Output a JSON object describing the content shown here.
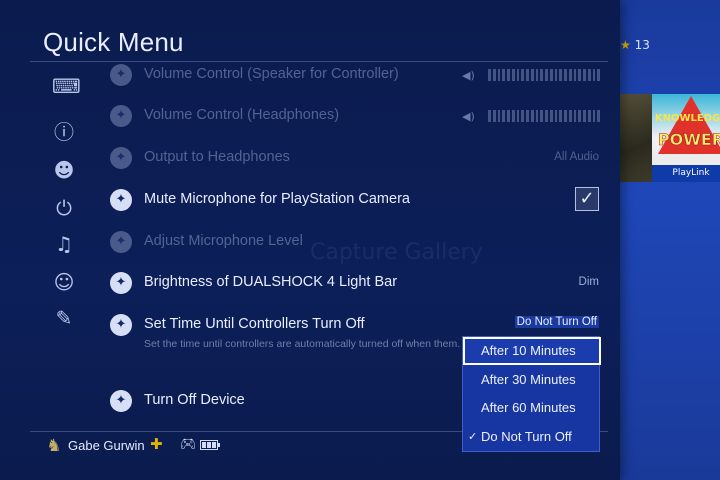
{
  "header": {
    "title": "Quick Menu",
    "trophy_count": "13"
  },
  "background": {
    "ghost_text": "Capture Gallery",
    "game_title_top": "KNOWLEDGE",
    "game_title": "POWER",
    "playlink": "PlayLink"
  },
  "sidebar": {
    "icons": [
      "controller-settings-icon",
      "info-icon",
      "party-icon",
      "power-icon",
      "music-icon",
      "dualshock-icon",
      "customize-icon"
    ]
  },
  "settings": [
    {
      "label": "Volume Control (Speaker for Controller)",
      "type": "slider",
      "enabled": false
    },
    {
      "label": "Volume Control (Headphones)",
      "type": "slider",
      "enabled": false
    },
    {
      "label": "Output to Headphones",
      "value": "All Audio",
      "enabled": false
    },
    {
      "label": "Mute Microphone for PlayStation Camera",
      "type": "checkbox",
      "checked": true,
      "enabled": true
    },
    {
      "label": "Adjust Microphone Level",
      "enabled": false
    },
    {
      "label": "Brightness of DUALSHOCK 4 Light Bar",
      "value": "Dim",
      "enabled": true
    },
    {
      "label": "Set Time Until Controllers Turn Off",
      "value": "Do Not Turn Off",
      "description": "Set the time until controllers are automatically turned off when them.",
      "enabled": true
    },
    {
      "label": "Turn Off Device",
      "enabled": true
    }
  ],
  "dropdown": {
    "options": [
      "After 10 Minutes",
      "After 30 Minutes",
      "After 60 Minutes",
      "Do Not Turn Off"
    ],
    "focused_index": 0,
    "checked_index": 3
  },
  "footer": {
    "username": "Gabe Gurwin"
  },
  "colors": {
    "panel_bg": "#0c1f58",
    "dropdown_bg": "#1736a2",
    "accent_gold": "#e0b300"
  }
}
